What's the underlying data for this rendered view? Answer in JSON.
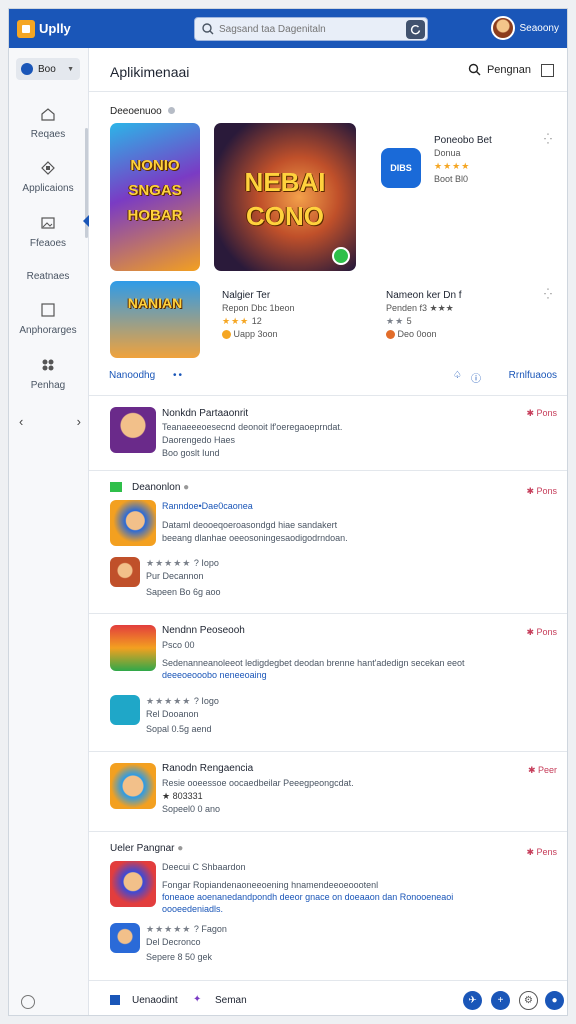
{
  "topbar": {
    "logo_text": "Uplly",
    "search_placeholder": "Sagsand taa Dagenitaln",
    "user_name": "Seaoony"
  },
  "sidebar": {
    "pill_label": "Boo",
    "items": [
      {
        "label": "Reqaes",
        "icon": "home-icon"
      },
      {
        "label": "Applicaions",
        "icon": "apps-icon"
      },
      {
        "label": "Ffeaoes",
        "icon": "image-icon"
      },
      {
        "label": "Reatnaes",
        "icon": "list-icon"
      },
      {
        "label": "Anphorarges",
        "icon": "square-icon"
      },
      {
        "label": "Penhag",
        "icon": "people-icon"
      }
    ]
  },
  "header": {
    "title": "Aplikimenaai",
    "search_label": "Pengnan"
  },
  "featured": {
    "title": "Deeoenuoo",
    "art1": "NONIO SNGAS HOBAR",
    "art2": "NEBAI CONO",
    "art3": "NANIAN",
    "app_right1": {
      "title": "Poneobo Bet",
      "sub": "Donua",
      "stars": "★★★★",
      "size": "Boot Bl0"
    },
    "app_right1_badge": "DIBS",
    "app_mid2": {
      "title": "Nalgier Ter",
      "sub": "Repon Dbc 1beon",
      "stars": "★★★",
      "rating": "12",
      "size": "Uapp 3oon"
    },
    "app_right2": {
      "title": "Nameon ker Dn f",
      "sub": "Penden f3 ★★★",
      "stars": "★★",
      "rating": "5",
      "size": "Deo 0oon"
    },
    "link_left": "Nanoodhg",
    "link_right": "Rrnlfuaoos"
  },
  "rows": [
    {
      "title": "Nonkdn Partaaonrit",
      "text1": "Teanaeeeoesecnd deonoit lf'oeregaoeprndat.",
      "text2": "Daorengedo Haes",
      "text3": "Boo goslt Iund",
      "badge": "Pons"
    },
    {
      "section": "Deanonlon",
      "title_link": "Ranndoe•Dae0caonea",
      "text1": "Dataml deooeqoeroasondgd hiae sandakert",
      "text2": "beeang dlanhae oeeosoningesaodigodrndoan.",
      "stars": "★★★★★",
      "meta": "? Iopo",
      "sub1": "Pur Decannon",
      "sub2": "Sapeen Bo 6g aoo",
      "badge": "Pons"
    },
    {
      "title": "Nendnn Peoseooh",
      "text0": "Psco 00",
      "text1": "Sedenanneanoleeot ledigdegbet deodan brenne hant'adedign secekan eeot",
      "text2": "deeeoeooobo neneeoaing",
      "stars": "★★★★★",
      "meta": "? Iogo",
      "sub1": "Rel Dooanon",
      "sub2": "Sopal 0.5g aend",
      "badge": "Pons"
    },
    {
      "title": "Ranodn Rengaencia",
      "text1": "Resie ooeessoe oocaedbeilar Peeegpeongcdat.",
      "text2": "★ 803331",
      "text3": "Sopeel0 0 ano",
      "badge": "Peer"
    },
    {
      "section": "Ueler Pangnar",
      "text0": "Deecui C Shbaardon",
      "text1": "Fongar Ropiandenaoneeoening  hnamendeeoeoootenl",
      "text2": "foneaoe aoenanedandpondh deeor gnace on doeaaon dan Ronooeneaoi",
      "text3": "oooeedeniadls.",
      "stars": "★★★★★",
      "meta": "? Fagon",
      "sub1": "Del Decronco",
      "sub2": "Sepere 8 50 gek",
      "badge": "Pens"
    }
  ],
  "bottom": {
    "label1": "Uenaodint",
    "label2": "Seman"
  }
}
